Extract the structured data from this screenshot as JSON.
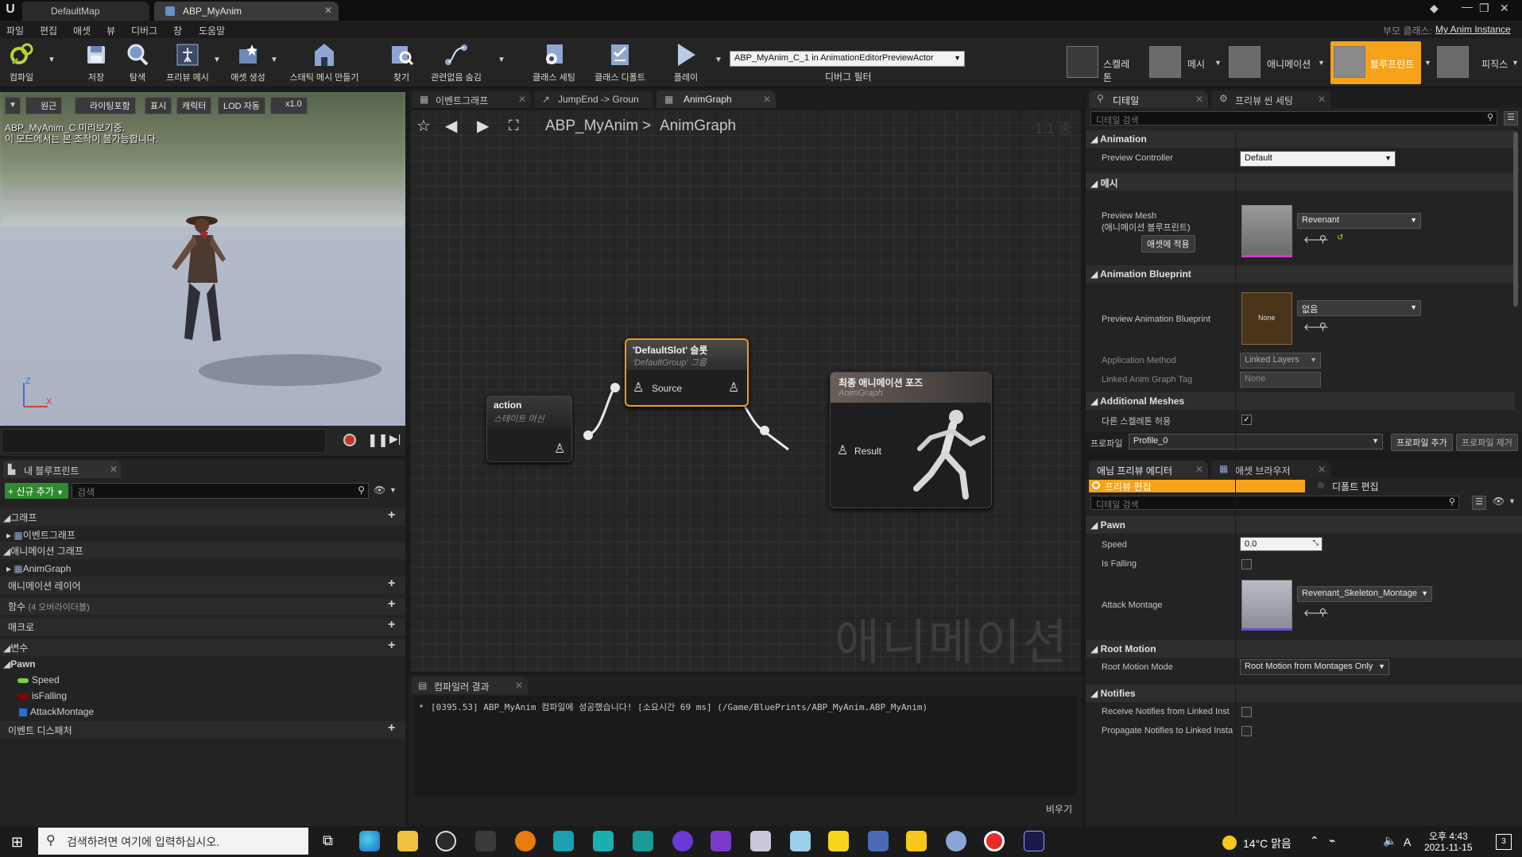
{
  "window": {
    "tabs": [
      {
        "label": "DefaultMap"
      },
      {
        "label": "ABP_MyAnim"
      }
    ],
    "top_right_links": {
      "parent_class_label": "부모 클래스:",
      "parent_class_value": "My Anim Instance"
    }
  },
  "menu": [
    "파일",
    "편집",
    "애셋",
    "뷰",
    "디버그",
    "창",
    "도움말"
  ],
  "toolbar": {
    "buttons": [
      {
        "label": "컴파일"
      },
      {
        "label": "저장"
      },
      {
        "label": "탐색"
      },
      {
        "label": "프리뷰 메시"
      },
      {
        "label": "애셋 생성"
      },
      {
        "label": "스태틱 메시 만들기"
      },
      {
        "label": "찾기"
      },
      {
        "label": "관련없음 숨김"
      },
      {
        "label": "클래스 세팅"
      },
      {
        "label": "클래스 디폴트"
      },
      {
        "label": "플레이"
      }
    ],
    "debug_object": "ABP_MyAnim_C_1 in AnimationEditorPreviewActor",
    "debug_filter_label": "디버그 필터",
    "modes": [
      {
        "label": "스켈레톤"
      },
      {
        "label": "메시"
      },
      {
        "label": "애니메이션"
      },
      {
        "label": "블루프린트"
      },
      {
        "label": "피직스"
      }
    ]
  },
  "viewport": {
    "buttons": [
      "원근",
      "라이팅포함",
      "표시",
      "캐릭터",
      "LOD 자동",
      "x1.0"
    ],
    "overlay_line1": "ABP_MyAnim_C 미리보기중.",
    "overlay_line2": "이 모드에서는 본 조작이 불가능합니다.",
    "axis_z": "Z",
    "axis_x": "X"
  },
  "my_blueprint": {
    "tab_label": "내 블루프린트",
    "add_new": "신규 추가",
    "search_placeholder": "검색",
    "rows": {
      "graph": "그래프",
      "event_graph": "이벤트그래프",
      "anim_graphs": "애니메이션 그래프",
      "anim_graph": "AnimGraph",
      "anim_layers": "애니메이션 레이어",
      "functions": "함수",
      "functions_note": "(4 오버라이더블)",
      "macros": "매크로",
      "variables": "변수",
      "pawn": "Pawn",
      "event_dispatchers": "이벤트 디스패처"
    },
    "variables": [
      {
        "name": "Speed",
        "color": "#7cd04a"
      },
      {
        "name": "isFalling",
        "color": "#8b0000"
      },
      {
        "name": "AttackMontage",
        "color": "#2a6fd0"
      }
    ]
  },
  "graph_tabs": [
    {
      "label": "이벤트그래프"
    },
    {
      "label": "JumpEnd -> Groun"
    },
    {
      "label": "AnimGraph"
    }
  ],
  "graph": {
    "breadcrumb_root": "ABP_MyAnim",
    "breadcrumb_sep": ">",
    "breadcrumb_current": "AnimGraph",
    "zoom": "1:1 줌",
    "watermark": "애니메이션",
    "nodes": {
      "action": {
        "title": "action",
        "subtitle": "스테이트 머신"
      },
      "slot": {
        "title": "'DefaultSlot' 슬롯",
        "subtitle": "'DefaultGroup' 그룹",
        "pin": "Source"
      },
      "output": {
        "title": "최종 애니메이션 포즈",
        "subtitle": "AnimGraph",
        "pin": "Result"
      }
    }
  },
  "compiler": {
    "tab_label": "컴파일러 결과",
    "message": "[0395.53] ABP_MyAnim 컴파일에 성공했습니다! [소요시간 69 ms] (/Game/BluePrints/ABP_MyAnim.ABP_MyAnim)",
    "clear": "비우기"
  },
  "details": {
    "tabs": [
      {
        "label": "디테일"
      },
      {
        "label": "프리뷰 씬 세팅"
      }
    ],
    "search_placeholder": "디테일 검색",
    "sections": {
      "animation": "Animation",
      "mesh": "메시",
      "anim_bp": "Animation Blueprint",
      "additional": "Additional Meshes"
    },
    "preview_controller_label": "Preview Controller",
    "preview_controller_value": "Default",
    "preview_mesh_label1": "Preview Mesh",
    "preview_mesh_label2": "(애니메이션 블루프린트)",
    "apply_button": "애셋에 적용",
    "preview_mesh_value": "Revenant",
    "preview_anim_bp_label": "Preview Animation Blueprint",
    "none_thumb": "None",
    "preview_anim_bp_value": "없음",
    "app_method_label": "Application Method",
    "app_method_value": "Linked Layers",
    "linked_tag_label": "Linked Anim Graph Tag",
    "linked_tag_value": "None",
    "allow_diff_label": "다른 스켈레톤 허용",
    "allow_diff_checked": true,
    "profile_label": "프로파일",
    "profile_value": "Profile_0",
    "add_profile": "프로파일 추가",
    "remove_profile": "프로파일 제거"
  },
  "anim_preview": {
    "tabs": [
      {
        "label": "애님 프리뷰 에디터"
      },
      {
        "label": "애셋 브라우저"
      }
    ],
    "edit_preview": "프리뷰 편집",
    "edit_defaults": "디폴트 편집",
    "search_placeholder": "디테일 검색",
    "sections": {
      "pawn": "Pawn",
      "root_motion": "Root Motion",
      "notifies": "Notifies"
    },
    "speed_label": "Speed",
    "speed_value": "0.0",
    "is_falling_label": "Is Falling",
    "attack_montage_label": "Attack Montage",
    "attack_montage_value": "Revenant_Skeleton_Montage",
    "root_motion_mode_label": "Root Motion Mode",
    "root_motion_mode_value": "Root Motion from Montages Only",
    "receive_notifies_label": "Receive Notifies from Linked Inst",
    "propagate_notifies_label": "Propagate Notifies to Linked Insta"
  },
  "taskbar": {
    "search_placeholder": "검색하려면 여기에 입력하십시오.",
    "weather": "14°C  맑음",
    "ime": "A",
    "time": "오후 4:43",
    "date": "2021-11-15",
    "notif_count": "3"
  },
  "colors": {
    "accent_orange": "#f7a21b",
    "selected_node": "#f39c12"
  }
}
